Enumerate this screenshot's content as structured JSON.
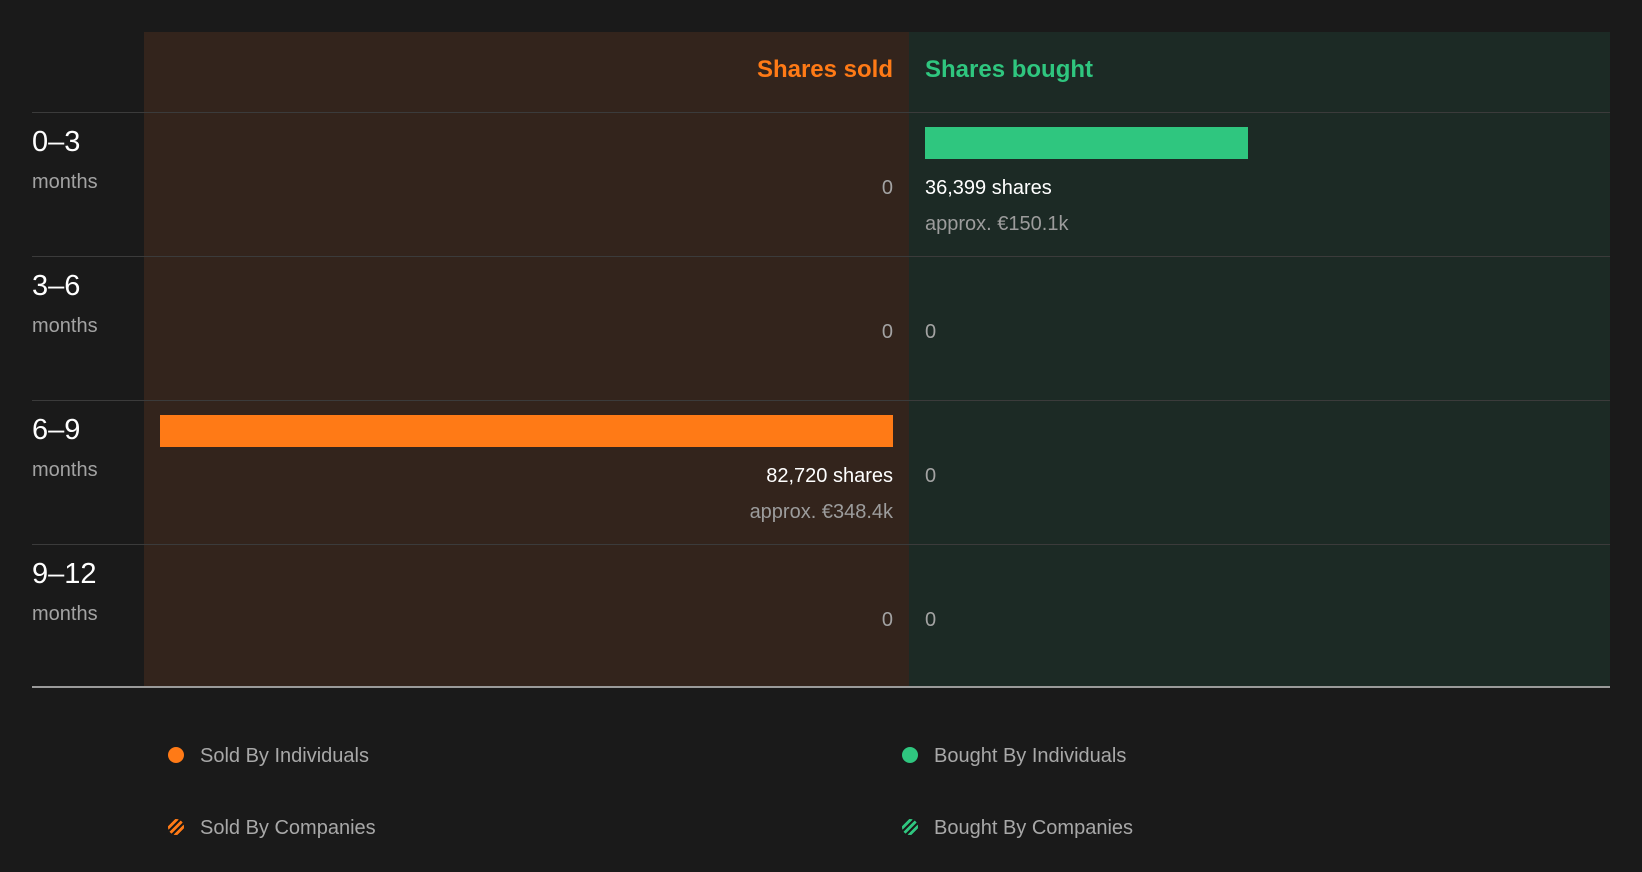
{
  "chart_data": {
    "type": "bar",
    "orientation": "horizontal-diverging",
    "headers": {
      "sold": "Shares sold",
      "bought": "Shares bought"
    },
    "rows": [
      {
        "range": "0–3",
        "unit": "months",
        "sold": 0,
        "bought": 36399,
        "sold_text": "0",
        "bought_text": "36,399 shares",
        "bought_approx": "approx. €150.1k"
      },
      {
        "range": "3–6",
        "unit": "months",
        "sold": 0,
        "bought": 0,
        "sold_text": "0",
        "bought_text": "0"
      },
      {
        "range": "6–9",
        "unit": "months",
        "sold": 82720,
        "bought": 0,
        "sold_text": "82,720 shares",
        "sold_approx": "approx. €348.4k",
        "bought_text": "0"
      },
      {
        "range": "9–12",
        "unit": "months",
        "sold": 0,
        "bought": 0,
        "sold_text": "0",
        "bought_text": "0"
      }
    ],
    "legend": [
      {
        "label": "Sold By Individuals",
        "color": "#ff7a16",
        "style": "solid"
      },
      {
        "label": "Sold By Companies",
        "color": "#ff7a16",
        "style": "striped"
      },
      {
        "label": "Bought By Individuals",
        "color": "#2fc67f",
        "style": "solid"
      },
      {
        "label": "Bought By Companies",
        "color": "#2fc67f",
        "style": "striped"
      }
    ],
    "colors": {
      "sold": "#ff7a16",
      "bought": "#2fc67f"
    }
  }
}
